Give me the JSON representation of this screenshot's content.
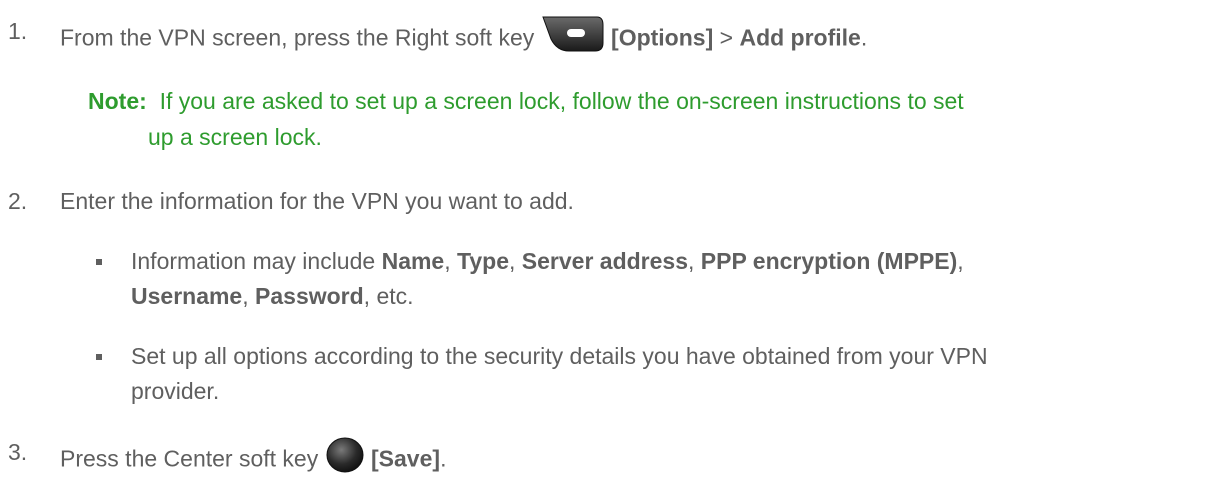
{
  "steps": [
    {
      "number": "1.",
      "parts": {
        "pre": "From the VPN screen, press the Right soft key ",
        "btn": "[Options]",
        "mid": " > ",
        "opt": "Add profile",
        "post": "."
      },
      "key_icon": "right-soft-key-icon"
    },
    {
      "number": "2.",
      "text": "Enter the information for the VPN you want to add."
    },
    {
      "number": "3.",
      "parts": {
        "pre": "Press the Center soft key ",
        "btn": "[Save]",
        "post": "."
      },
      "key_icon": "center-soft-key-icon"
    }
  ],
  "note": {
    "label": "Note:",
    "line1": "If you are asked to set up a screen lock, follow the on-screen instructions to set",
    "line2": "up a screen lock."
  },
  "bullets": [
    {
      "line1": {
        "t1": "Information may include ",
        "b1": "Name",
        "t2": ", ",
        "b2": "Type",
        "t3": ", ",
        "b3": "Server address",
        "t4": ", ",
        "b4": "PPP encryption (MPPE)",
        "t5": ","
      },
      "line2": {
        "b5": "Username",
        "t6": ", ",
        "b6": "Password",
        "t7": ", etc."
      }
    },
    {
      "line1": "Set up all options according to the security details you have obtained from your VPN",
      "line2": "provider."
    }
  ],
  "colors": {
    "body_text": "#5f5f5f",
    "note_green": "#2e9c2e"
  }
}
